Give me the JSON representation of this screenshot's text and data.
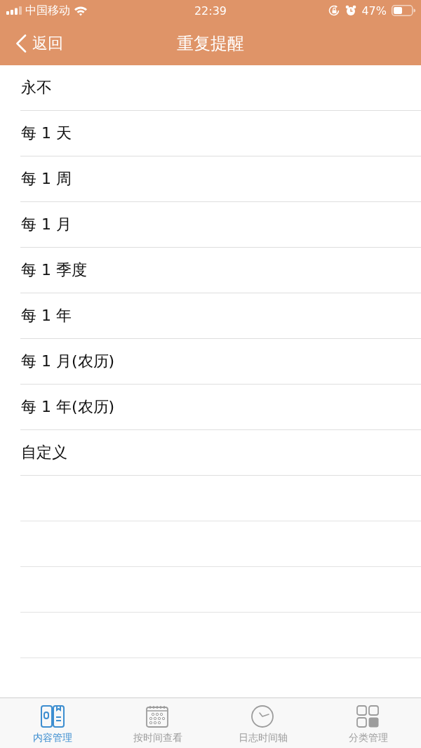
{
  "status_bar": {
    "carrier": "中国移动",
    "time": "22:39",
    "battery": "47%"
  },
  "nav_bar": {
    "back": "返回",
    "title": "重复提醒"
  },
  "options": [
    {
      "label": "永不"
    },
    {
      "label": "每 1 天"
    },
    {
      "label": "每 1 周"
    },
    {
      "label": "每 1 月"
    },
    {
      "label": "每 1 季度"
    },
    {
      "label": "每 1 年"
    },
    {
      "label": "每 1 月(农历)"
    },
    {
      "label": "每 1 年(农历)"
    },
    {
      "label": "自定义"
    }
  ],
  "tab_bar": [
    {
      "label": "内容管理",
      "selected": true
    },
    {
      "label": "按时间查看",
      "selected": false
    },
    {
      "label": "日志时间轴",
      "selected": false
    },
    {
      "label": "分类管理",
      "selected": false
    }
  ]
}
